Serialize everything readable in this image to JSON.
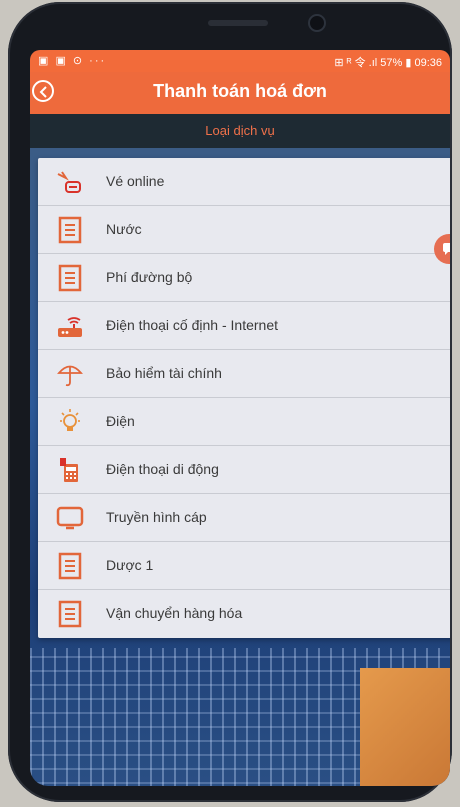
{
  "status_bar": {
    "left_icons": "▣ ▣ ⊙ ···",
    "right": "⊞ ᴿ 令 .ıl 57% ▮ 09:36"
  },
  "header": {
    "title": "Thanh toán hoá đơn",
    "subtitle": "Loại dịch vụ"
  },
  "colors": {
    "accent": "#ee6a3c",
    "icon_orange": "#e2663a",
    "icon_red": "#d9322a"
  },
  "services": [
    {
      "label": "Vé online",
      "icon": "plane-ticket-icon"
    },
    {
      "label": "Nước",
      "icon": "document-icon"
    },
    {
      "label": "Phí đường bộ",
      "icon": "document-icon"
    },
    {
      "label": "Điện thoại cố định - Internet",
      "icon": "router-icon"
    },
    {
      "label": "Bảo hiểm tài chính",
      "icon": "umbrella-icon"
    },
    {
      "label": "Điện",
      "icon": "lightbulb-icon"
    },
    {
      "label": "Điện thoại di động",
      "icon": "mobile-phone-icon"
    },
    {
      "label": "Truyền hình cáp",
      "icon": "tv-icon"
    },
    {
      "label": "Dược 1",
      "icon": "document-icon"
    },
    {
      "label": "Vận chuyển hàng hóa",
      "icon": "document-icon"
    }
  ]
}
